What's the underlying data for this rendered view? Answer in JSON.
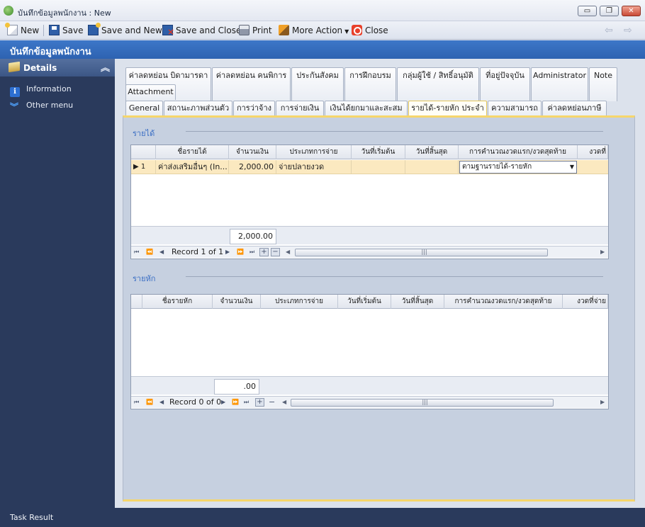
{
  "window": {
    "title": "บันทึกข้อมูลพนักงาน : New",
    "buttons": {
      "minimize": "▭",
      "restore": "❐",
      "close": "✕"
    }
  },
  "toolbar": {
    "new": "New",
    "save": "Save",
    "save_new": "Save and New",
    "save_close": "Save and Close",
    "print": "Print",
    "more_action": "More Action",
    "close": "Close",
    "back_arrow": "⇦",
    "forward_arrow": "⇨"
  },
  "form_header": "บันทึกข้อมูลพนักงาน",
  "nav": {
    "header": "Details",
    "items": [
      {
        "label": "Information",
        "icon": "info-icon"
      },
      {
        "label": "Other menu",
        "icon": "chevron-down-icon"
      }
    ]
  },
  "tabs": {
    "row1": [
      "ค่าลดหย่อน บิดามารดา",
      "ค่าลดหย่อน คนพิการ",
      "ประกันสังคม",
      "การฝึกอบรม",
      "กลุ่มผู้ใช้ / สิทธิ์อนุมัติ",
      "ที่อยู่ปัจจุบัน",
      "Administrator",
      "Note"
    ],
    "row1b": [
      "Attachment"
    ],
    "row2": [
      "General",
      "สถานะภาพส่วนตัว",
      "การว่าจ้าง",
      "การจ่ายเงิน",
      "เงินได้ยกมาและสะสม",
      "รายได้-รายหัก ประจำ",
      "ความสามารถ",
      "ค่าลดหย่อนภาษี"
    ],
    "active": "รายได้-รายหัก ประจำ"
  },
  "income": {
    "group_title": "รายได้",
    "columns": [
      "ชื่อรายได้",
      "จำนวนเงิน",
      "ประเภทการจ่าย",
      "วันที่เริ่มต้น",
      "วันที่สิ้นสุด",
      "การคำนวณงวดแรก/งวดสุดท้าย",
      "งวดที่"
    ],
    "rows": [
      {
        "indicator": "▶ 1",
        "name": "ค่าส่งเสริมอื่นๆ (In...",
        "amount": "2,000.00",
        "pay_type": "จ่ายปลายงวด",
        "start": "",
        "end": "",
        "calc": "ตามฐานรายได้-รายหัก",
        "period": ""
      }
    ],
    "total": "2,000.00",
    "navigator": "Record 1 of 1"
  },
  "deduction": {
    "group_title": "รายหัก",
    "columns": [
      "ชื่อรายหัก",
      "จำนวนเงิน",
      "ประเภทการจ่าย",
      "วันที่เริ่มต้น",
      "วันที่สิ้นสุด",
      "การคำนวณงวดแรก/งวดสุดท้าย",
      "งวดที่จ่าย"
    ],
    "rows": [],
    "total": ".00",
    "navigator": "Record 0 of 0"
  },
  "status_bar": "Task Result",
  "colors": {
    "header_blue": "#3d77c8",
    "left_panel": "#2a3a5c",
    "selected_row": "#fbe9c0",
    "active_tab_border": "#e4c65a"
  }
}
